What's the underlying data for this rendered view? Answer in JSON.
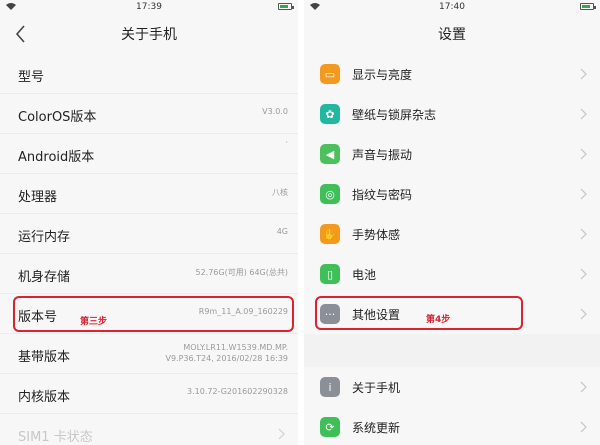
{
  "left": {
    "status_time": "17:39",
    "title": "关于手机",
    "rows": [
      {
        "label": "型号",
        "value": ""
      },
      {
        "label": "ColorOS版本",
        "value": "V3.0.0"
      },
      {
        "label": "Android版本",
        "value": "·"
      },
      {
        "label": "处理器",
        "value": "八核"
      },
      {
        "label": "运行内存",
        "value": "4G"
      },
      {
        "label": "机身存储",
        "value": "52.76G(可用)  64G(总共)"
      },
      {
        "label": "版本号",
        "value": "R9m_11_A.09_160229"
      },
      {
        "label": "基带版本",
        "value": "MOLY.LR11.W1539.MD.MP.",
        "value2": "V9.P36.T24, 2016/02/28 16:39"
      },
      {
        "label": "内核版本",
        "value": "3.10.72-G201602290328"
      },
      {
        "label": "SIM1 卡状态",
        "value": ""
      }
    ],
    "step_label": "第三步"
  },
  "right": {
    "status_time": "17:40",
    "title": "设置",
    "items": [
      {
        "label": "显示与亮度",
        "icon": "display-brightness-icon",
        "color": "#f39a1e",
        "glyph": "▭"
      },
      {
        "label": "壁纸与锁屏杂志",
        "icon": "wallpaper-icon",
        "color": "#22b8a0",
        "glyph": "✿"
      },
      {
        "label": "声音与振动",
        "icon": "sound-icon",
        "color": "#4cc05a",
        "glyph": "◀"
      },
      {
        "label": "指纹与密码",
        "icon": "fingerprint-icon",
        "color": "#3fbf58",
        "glyph": "◎"
      },
      {
        "label": "手势体感",
        "icon": "gesture-icon",
        "color": "#f39a1e",
        "glyph": "✋"
      },
      {
        "label": "电池",
        "icon": "battery-icon",
        "color": "#3fbf58",
        "glyph": "▯"
      },
      {
        "label": "其他设置",
        "icon": "more-settings-icon",
        "color": "#8a8f98",
        "glyph": "···"
      }
    ],
    "items2": [
      {
        "label": "关于手机",
        "icon": "about-phone-icon",
        "color": "#8a8f98",
        "glyph": "i"
      },
      {
        "label": "系统更新",
        "icon": "system-update-icon",
        "color": "#3fbf58",
        "glyph": "⟳"
      }
    ],
    "step_label": "第4步"
  },
  "colors": {
    "highlight": "#d9232f"
  }
}
